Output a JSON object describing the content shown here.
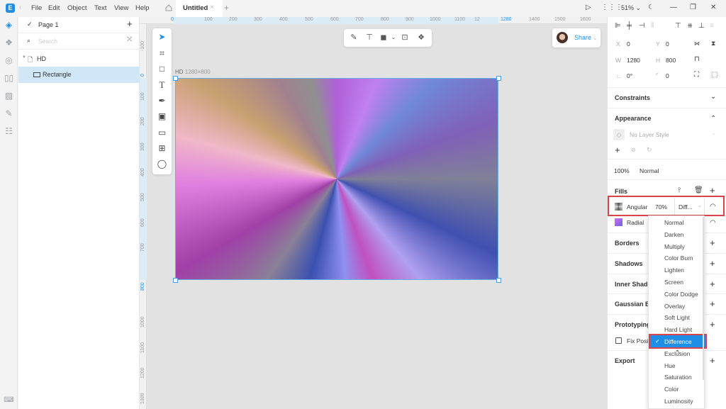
{
  "titlebar": {
    "app_icon": "app-logo-icon",
    "menu": [
      "File",
      "Edit",
      "Object",
      "Text",
      "View",
      "Help"
    ],
    "tab_title": "Untitled",
    "zoom": "51%",
    "icons": [
      "play-icon",
      "grid-icon",
      "moon-icon",
      "minimize-icon",
      "restore-icon",
      "close-icon"
    ]
  },
  "rail": {
    "icons": [
      "layers-icon",
      "components-icon",
      "styles-icon",
      "plugins-icon",
      "assets-icon",
      "edit-icon",
      "inspect-icon",
      "keyboard-icon"
    ]
  },
  "layers": {
    "page": "Page 1",
    "search_placeholder": "Search",
    "items": [
      {
        "name": "HD",
        "type": "frame"
      },
      {
        "name": "Rectangle",
        "type": "rectangle",
        "selected": true
      }
    ]
  },
  "rulers": {
    "top": [
      "0",
      "100",
      "200",
      "300",
      "400",
      "500",
      "600",
      "700",
      "800",
      "900",
      "1000",
      "1100",
      "12",
      "1280",
      "1400",
      "1500",
      "1600"
    ],
    "left": [
      "-100",
      "0",
      "100",
      "200",
      "300",
      "400",
      "500",
      "600",
      "700",
      "800",
      "1000",
      "1100",
      "1200",
      "1300"
    ]
  },
  "canvas": {
    "frame_label": "HD",
    "frame_size": "1280×800",
    "share_label": "Share"
  },
  "props": {
    "x": "0",
    "y": "0",
    "w": "1280",
    "h": "800",
    "rotation": "0°",
    "radius": "0",
    "x_label": "X",
    "y_label": "Y",
    "w_label": "W",
    "h_label": "H"
  },
  "sections": {
    "constraints": "Constraints",
    "appearance": "Appearance",
    "layer_style": "No Layer Style",
    "opacity": "100%",
    "blend": "Normal",
    "fills": "Fills",
    "borders": "Borders",
    "shadows": "Shadows",
    "inner_shadows": "Inner Shado",
    "gaussian": "Gaussian Bl",
    "prototyping": "Prototyping",
    "fix_position": "Fix Posi",
    "export": "Export"
  },
  "fills": [
    {
      "type": "Angular",
      "opacity": "70%",
      "blend": "Diff...",
      "visible": true
    },
    {
      "type": "Radial",
      "visible": true
    }
  ],
  "blend_dropdown": {
    "options": [
      "Normal",
      "Darken",
      "Multiply",
      "Color Burn",
      "Lighten",
      "Screen",
      "Color Dodge",
      "Overlay",
      "Soft Light",
      "Hard Light",
      "Difference",
      "Exclusion",
      "Hue",
      "Saturation",
      "Color",
      "Luminosity"
    ],
    "selected": "Difference"
  },
  "colors": {
    "accent": "#1f8ee6",
    "highlight": "#d9444b",
    "selection": "#cfe7f7"
  }
}
